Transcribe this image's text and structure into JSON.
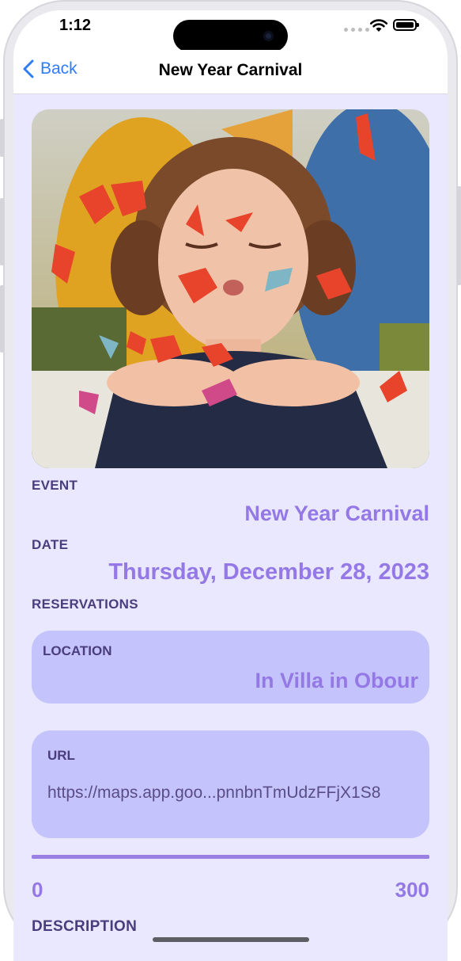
{
  "status_bar": {
    "time": "1:12"
  },
  "nav": {
    "back_label": "Back",
    "title": "New Year Carnival"
  },
  "event": {
    "label": "EVENT",
    "value": "New Year Carnival"
  },
  "date": {
    "label": "DATE",
    "value": "Thursday, December 28, 2023"
  },
  "reservations": {
    "label": "RESERVATIONS"
  },
  "location": {
    "label": "LOCATION",
    "value": "In Villa in Obour"
  },
  "url": {
    "label": "URL",
    "value": "https://maps.app.goo...pnnbnTmUdzFFjX1S8"
  },
  "range": {
    "min_label": "0",
    "max_label": "300",
    "fill_fraction": 1.0
  },
  "description": {
    "label": "DESCRIPTION"
  },
  "colors": {
    "accent": "#9479e6",
    "label": "#4a3d7e",
    "background": "#e9e8fe",
    "card": "#c5c3fb",
    "link": "#2f7cf6"
  },
  "icons": [
    "back-chevron-icon",
    "wifi-icon",
    "battery-icon",
    "cellular-icon"
  ]
}
